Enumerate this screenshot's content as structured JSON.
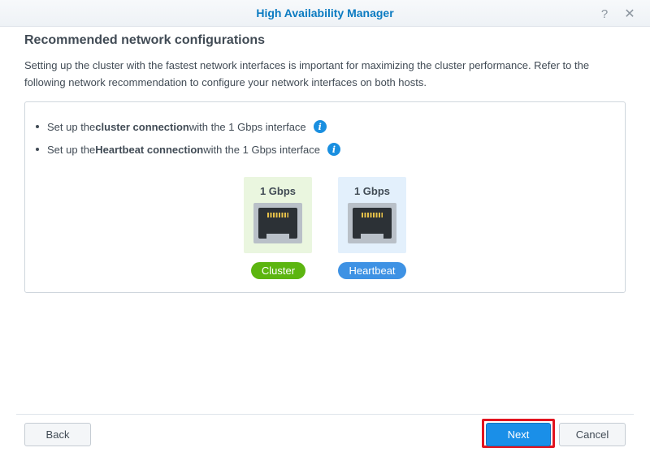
{
  "window": {
    "title": "High Availability Manager",
    "help_icon": "help-icon",
    "close_icon": "close-icon"
  },
  "content": {
    "heading": "Recommended network configurations",
    "description": "Setting up the cluster with the fastest network interfaces is important for maximizing the cluster performance. Refer to the following network recommendation to configure your network interfaces on both hosts.",
    "bullets": [
      {
        "prefix": "Set up the ",
        "bold": "cluster connection",
        "suffix": " with the 1 Gbps interface",
        "icon": "info-icon"
      },
      {
        "prefix": "Set up the ",
        "bold": "Heartbeat connection",
        "suffix": " with the 1 Gbps interface",
        "icon": "info-icon"
      }
    ],
    "ports": [
      {
        "speed": "1 Gbps",
        "label": "Cluster",
        "color": "#5cb510",
        "bg": "#eaf6df"
      },
      {
        "speed": "1 Gbps",
        "label": "Heartbeat",
        "color": "#3e92e4",
        "bg": "#e3f0fc"
      }
    ]
  },
  "footer": {
    "back_label": "Back",
    "next_label": "Next",
    "cancel_label": "Cancel",
    "highlight_color": "#e2141f"
  }
}
